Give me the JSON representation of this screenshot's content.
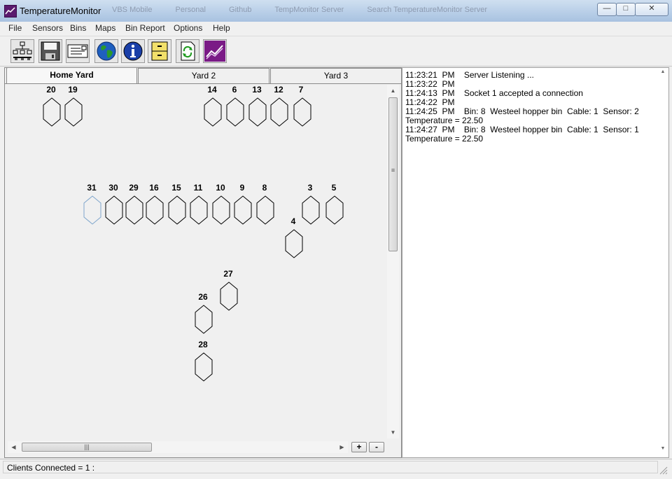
{
  "window": {
    "title": "TemperatureMonitor",
    "background_taskbar": [
      "VBS Mobile",
      "Personal",
      "Github",
      "TempMonitor Server",
      "Search TemperatureMonitor Server"
    ],
    "controls": {
      "minimize": "—",
      "maximize": "□",
      "close": "✕"
    }
  },
  "menu": [
    "File",
    "Sensors",
    "Bins",
    "Maps",
    "Bin Report",
    "Options",
    "Help"
  ],
  "toolbar": [
    {
      "name": "network-sensors-icon"
    },
    {
      "name": "save-disk-icon"
    },
    {
      "name": "cable-card-icon"
    },
    {
      "name": "globe-icon"
    },
    {
      "name": "info-icon"
    },
    {
      "name": "file-cabinet-icon"
    },
    {
      "name": "refresh-document-icon"
    },
    {
      "name": "trend-chart-icon"
    }
  ],
  "tabs": [
    "Home Yard",
    "Yard 2",
    "Yard 3"
  ],
  "active_tab": "Home Yard",
  "bins": [
    {
      "label": "20"
    },
    {
      "label": "19"
    },
    {
      "label": "14"
    },
    {
      "label": "6"
    },
    {
      "label": "13"
    },
    {
      "label": "12"
    },
    {
      "label": "7"
    },
    {
      "label": "31",
      "highlighted": true
    },
    {
      "label": "30"
    },
    {
      "label": "29"
    },
    {
      "label": "16"
    },
    {
      "label": "15"
    },
    {
      "label": "11"
    },
    {
      "label": "10"
    },
    {
      "label": "9"
    },
    {
      "label": "8"
    },
    {
      "label": "3"
    },
    {
      "label": "5"
    },
    {
      "label": "4"
    },
    {
      "label": "27"
    },
    {
      "label": "26"
    },
    {
      "label": "28"
    }
  ],
  "zoom": {
    "in": "+",
    "out": "-"
  },
  "log": [
    "11:23:21  PM    Server Listening ...",
    "11:23:22  PM",
    "11:24:13  PM    Socket 1 accepted a connection",
    "11:24:22  PM",
    "11:24:25  PM    Bin: 8  Westeel hopper bin  Cable: 1  Sensor: 2",
    "Temperature = 22.50",
    "11:24:27  PM    Bin: 8  Westeel hopper bin  Cable: 1  Sensor: 1",
    "Temperature = 22.50"
  ],
  "status": {
    "text": "Clients Connected = 1 :"
  },
  "colors": {
    "bin_outline": "#000000",
    "bin_highlight": "#7fa6cc",
    "app_icon": "#5a1a6e"
  }
}
